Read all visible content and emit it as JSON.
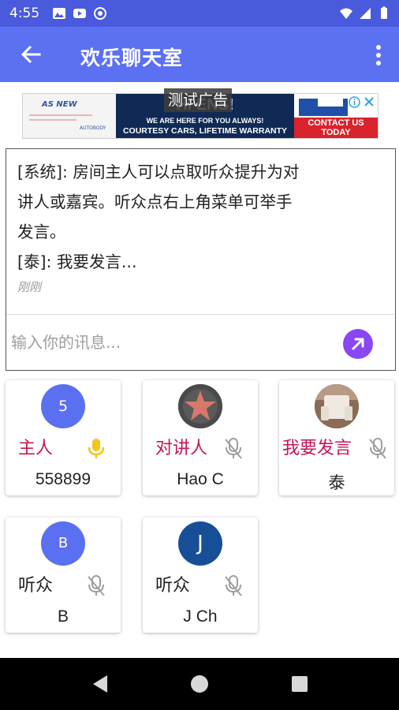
{
  "status_bar": {
    "time": "4:55",
    "icons_left": [
      "image-icon",
      "youtube-icon",
      "vpn-icon"
    ],
    "icons_right": [
      "wifi-icon",
      "signal-icon",
      "battery-icon"
    ]
  },
  "app_bar": {
    "title": "欢乐聊天室",
    "back_icon": "arrow-back-icon",
    "menu_icon": "more-vert-icon"
  },
  "ad": {
    "left_brand": "AS NEW",
    "left_small": "AUTOBODY",
    "headline": "HI        ENS!",
    "line1": "WE ARE HERE FOR YOU ALWAYS!",
    "line2": "COURTESY CARS, LIFETIME WARRANTY",
    "cta_line1": "CONTACT US",
    "cta_line2": "TODAY",
    "test_label": "测试广告"
  },
  "chat": {
    "messages": [
      {
        "text": "[系统]: 房间主人可以点取听众提升为对"
      },
      {
        "text": "讲人或嘉宾。听众点右上角菜单可举手"
      },
      {
        "text": "发言。"
      },
      {
        "text": "[泰]: 我要发言..."
      }
    ],
    "timestamp": "刚刚",
    "input_placeholder": "输入你的讯息...",
    "send_icon": "send-arrow-icon"
  },
  "members": [
    {
      "avatar": "5",
      "role": "主人",
      "name": "558899",
      "mic": "mic-on",
      "mic_color": "#f5c518"
    },
    {
      "avatar": "star-photo",
      "role": "对讲人",
      "name": "Hao C",
      "mic": "mic-off"
    },
    {
      "avatar": "chair-photo",
      "role": "我要发言",
      "name": "泰",
      "mic": "mic-off"
    },
    {
      "avatar": "B",
      "role": "听众",
      "name": "B",
      "mic": "mic-off"
    },
    {
      "avatar": "J",
      "role": "听众",
      "name": "J Ch",
      "mic": "mic-off"
    }
  ],
  "colors": {
    "status_bar": "#4a5adc",
    "app_bar": "#5c70f2",
    "send_button": "#8a46f3",
    "role_highlight": "#c2185b",
    "mic_on": "#f5c518"
  },
  "nav_bar": {
    "icons": [
      "nav-back-icon",
      "nav-home-icon",
      "nav-recents-icon"
    ]
  }
}
